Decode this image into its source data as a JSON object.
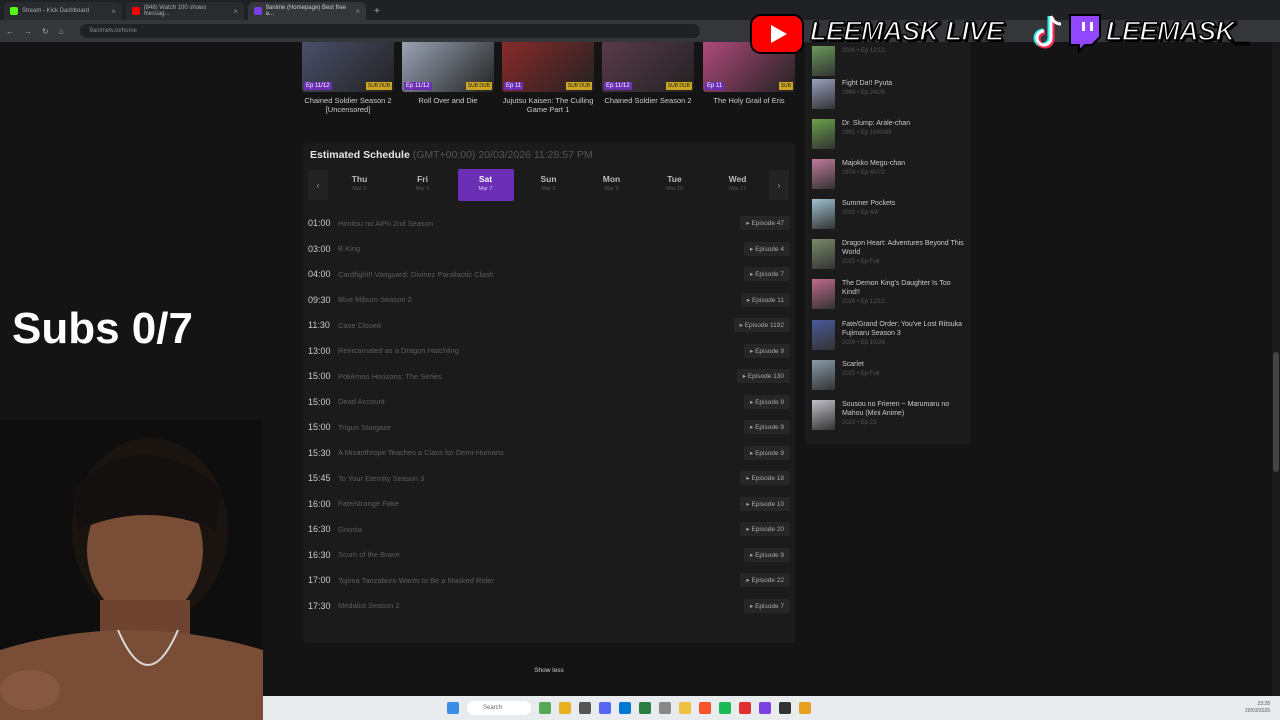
{
  "browser": {
    "tabs": [
      {
        "label": "Stream - Kick Dashboard",
        "color": "#53fc18"
      },
      {
        "label": "(848) Watch 100 shows messag...",
        "color": "#ff0000"
      },
      {
        "label": "9anime (Homepage) Best free a...",
        "color": "#7b3fe4",
        "active": true
      }
    ],
    "address": "9animetv.to/home"
  },
  "anime_cards": [
    {
      "ep": "Ep 11/12",
      "sub_dub": "SUB  DUB",
      "title": "Chained Soldier Season 2 [Uncensored]",
      "color": "#4a4f6a"
    },
    {
      "ep": "Ep 11/12",
      "sub_dub": "SUB  DUB",
      "title": "Roll Over and Die",
      "color": "#9aa3b5"
    },
    {
      "ep": "Ep 11",
      "sub_dub": "SUB  DUB",
      "title": "Jujutsu Kaisen: The Culling Game Part 1",
      "color": "#8a2a2a"
    },
    {
      "ep": "Ep 11/12",
      "sub_dub": "SUB  DUB",
      "title": "Chained Soldier Season 2",
      "color": "#5a3a4a"
    },
    {
      "ep": "Ep 11",
      "sub_dub": "SUB",
      "title": "The Holy Grail of Eris",
      "color": "#b04a7a"
    }
  ],
  "schedule": {
    "title": "Estimated Schedule",
    "timezone": "(GMT+00:00) 20/03/2026 11:28:57 PM",
    "days": [
      {
        "name": "Thu",
        "date": "Mar 5"
      },
      {
        "name": "Fri",
        "date": "Mar 6"
      },
      {
        "name": "Sat",
        "date": "Mar 7",
        "active": true
      },
      {
        "name": "Sun",
        "date": "Mar 8"
      },
      {
        "name": "Mon",
        "date": "Mar 9"
      },
      {
        "name": "Tue",
        "date": "Mar 10"
      },
      {
        "name": "Wed",
        "date": "Mar 11"
      }
    ],
    "entries": [
      {
        "time": "01:00",
        "title": "Himitsu no AiPri 2nd Season",
        "episode": "▸ Episode 47"
      },
      {
        "time": "03:00",
        "title": "B.King",
        "episode": "▸ Episode 4"
      },
      {
        "time": "04:00",
        "title": "Cardfight!! Vanguard: Divinez Parallactic Clash",
        "episode": "▸ Episode 7"
      },
      {
        "time": "09:30",
        "title": "Blue Miburo Season 2",
        "episode": "▸ Episode 11"
      },
      {
        "time": "11:30",
        "title": "Case Closed",
        "episode": "▸ Episode 1192"
      },
      {
        "time": "13:00",
        "title": "Reincarnated as a Dragon Hatchling",
        "episode": "▸ Episode 9"
      },
      {
        "time": "15:00",
        "title": "Pokémon Horizons: The Series",
        "episode": "▸ Episode 130"
      },
      {
        "time": "15:00",
        "title": "Dead Account",
        "episode": "▸ Episode 9"
      },
      {
        "time": "15:00",
        "title": "Trigun Stargaze",
        "episode": "▸ Episode 9"
      },
      {
        "time": "15:30",
        "title": "A Misanthrope Teaches a Class for Demi-Humans",
        "episode": "▸ Episode 9"
      },
      {
        "time": "15:45",
        "title": "To Your Eternity Season 3",
        "episode": "▸ Episode 18"
      },
      {
        "time": "16:00",
        "title": "Fate/strange Fake",
        "episode": "▸ Episode 10"
      },
      {
        "time": "16:30",
        "title": "Gnosia",
        "episode": "▸ Episode 20"
      },
      {
        "time": "16:30",
        "title": "Scum of the Brave",
        "episode": "▸ Episode 9"
      },
      {
        "time": "17:00",
        "title": "Tojima Tanzaburo Wants to Be a Masked Rider",
        "episode": "▸ Episode 22"
      },
      {
        "time": "17:30",
        "title": "Medalist Season 2",
        "episode": "▸ Episode 7"
      }
    ],
    "show_less": "Show less"
  },
  "sidebar": [
    {
      "title": "",
      "meta": "2026  •  Ep 12/12",
      "color": "#6a9a5a"
    },
    {
      "title": "Fight Da!! Pyuta",
      "meta": "1969  •  Ep 24/26",
      "color": "#9aa0c0"
    },
    {
      "title": "Dr. Slump: Arale-chan",
      "meta": "1981  •  Ep 164/243",
      "color": "#6aa04a"
    },
    {
      "title": "Majokko Megu-chan",
      "meta": "1974  •  Ep 40/72",
      "color": "#c07a9a"
    },
    {
      "title": "Summer Pockets",
      "meta": "2025  •  Ep 4/4",
      "color": "#a0c0d0"
    },
    {
      "title": "Dragon Heart: Adventures Beyond This World",
      "meta": "2025  •  Ep Full",
      "color": "#7a8a6a"
    },
    {
      "title": "The Demon King's Daughter Is Too Kind!!",
      "meta": "2026  •  Ep 12/12",
      "color": "#c06a8a"
    },
    {
      "title": "Fate/Grand Order: You've Lost Ritsuka Fujimaru Season 3",
      "meta": "2026  •  Ep 10/24",
      "color": "#4a5a9a"
    },
    {
      "title": "Scarlet",
      "meta": "2025  •  Ep Full",
      "color": "#8a9aaa"
    },
    {
      "title": "Sousou no Frieren ~ Marumaru no Mahou (Mini Anime)",
      "meta": "2023  •  Ep 23",
      "color": "#c0c0c8"
    }
  ],
  "overlay": {
    "youtube_name": "LEEMASK LIVE",
    "twitch_name": "LEEMASK_",
    "subs": "Subs 0/7"
  },
  "taskbar": {
    "search_placeholder": "Search",
    "clock_time": "23:28",
    "clock_date": "20/03/2026"
  }
}
